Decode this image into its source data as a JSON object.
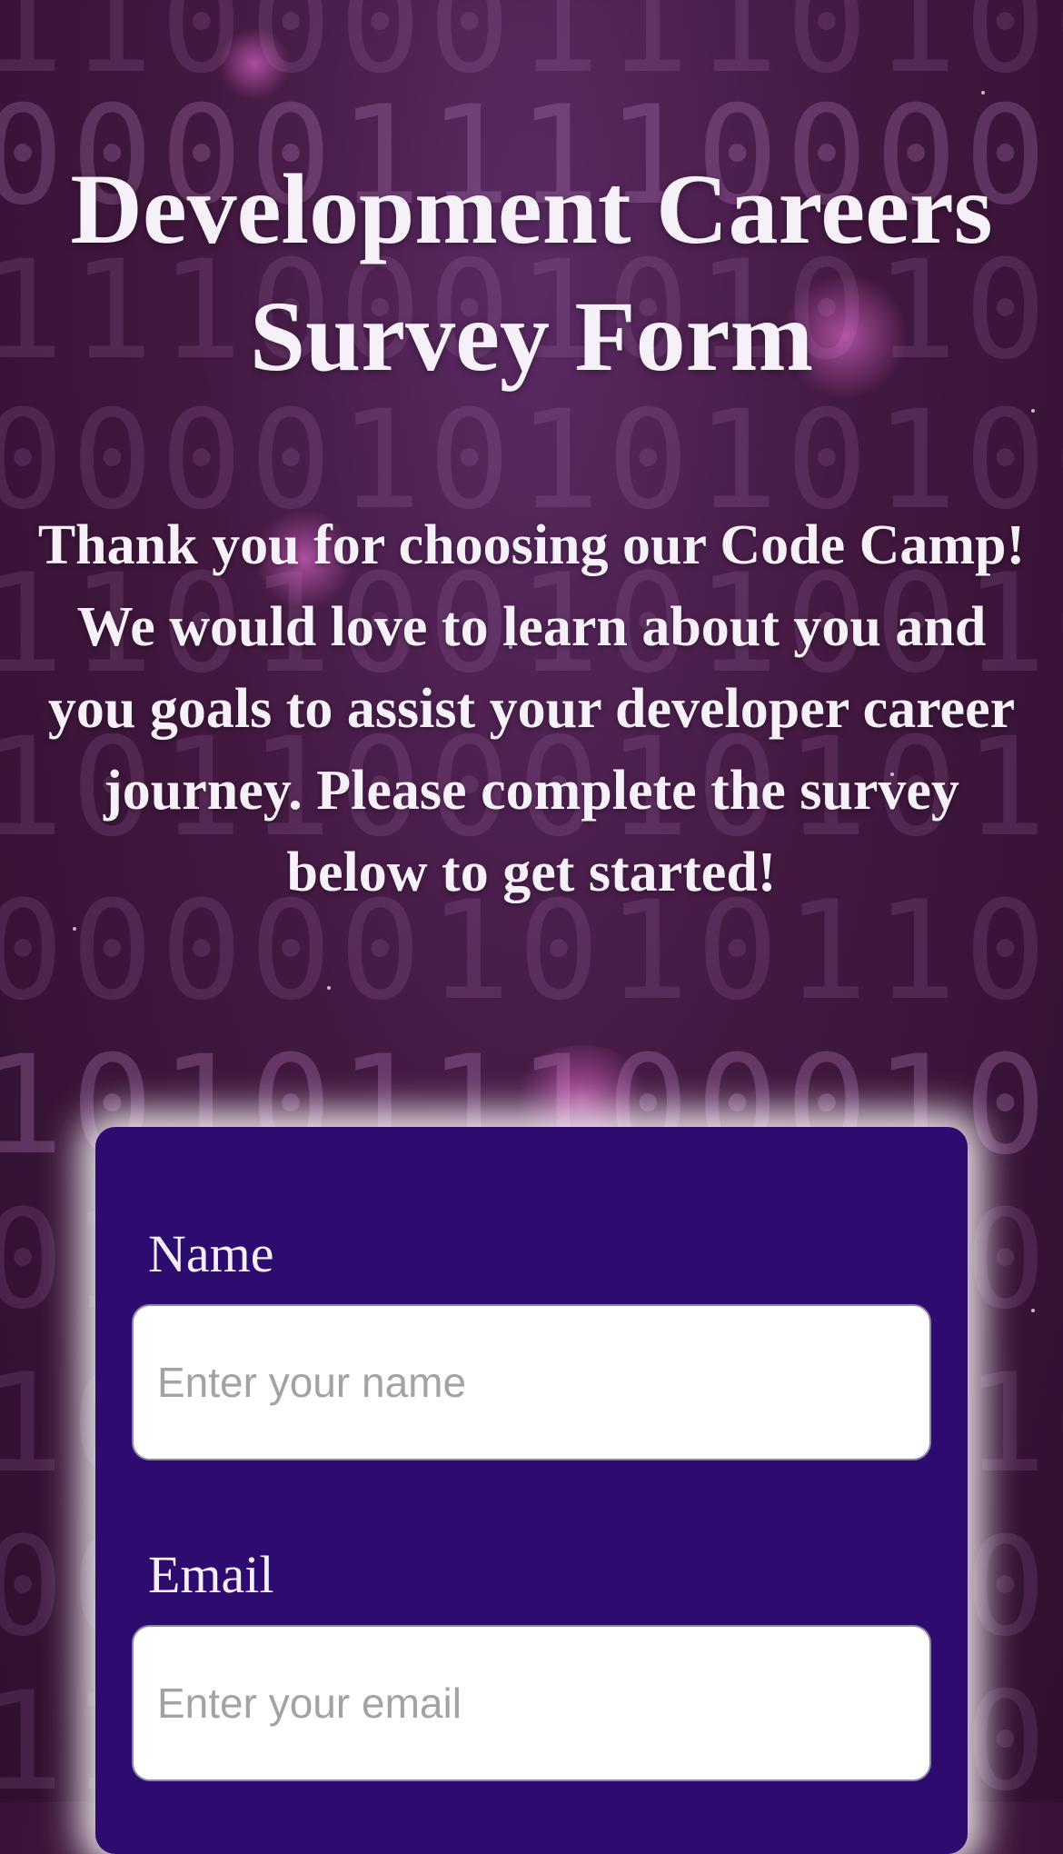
{
  "header": {
    "title_line1": "Development Careers",
    "title_line2": "Survey Form",
    "description": "Thank you for choosing our Code Camp! We would love to learn about you and you goals to assist your developer career journey. Please complete the survey below to get started!"
  },
  "form": {
    "name": {
      "label": "Name",
      "placeholder": "Enter your name",
      "value": ""
    },
    "email": {
      "label": "Email",
      "placeholder": "Enter your email",
      "value": ""
    }
  },
  "colors": {
    "background": "#42183f",
    "card": "#2e0b6f",
    "text": "#f6f1f8",
    "input_border": "#8d88a6"
  }
}
